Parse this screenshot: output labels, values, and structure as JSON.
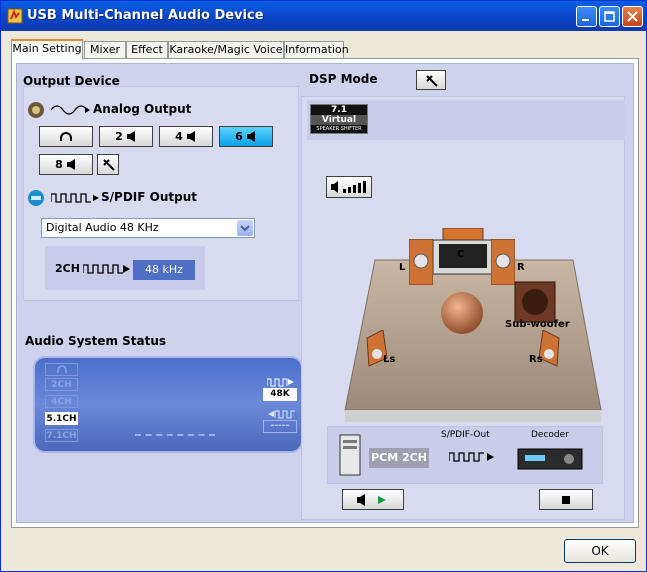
{
  "window": {
    "title": "USB Multi-Channel Audio Device"
  },
  "tabs": [
    "Main Setting",
    "Mixer",
    "Effect",
    "Karaoke/Magic Voice",
    "Information"
  ],
  "output_device": {
    "heading": "Output Device",
    "analog_label": "Analog Output",
    "channel_buttons": [
      "2",
      "4",
      "6",
      "8"
    ],
    "selected_channels": "6",
    "spdif_label": "S/PDIF Output",
    "spdif_select": "Digital Audio 48 KHz",
    "rate_prefix": "2CH",
    "rate_value": "48 kHz"
  },
  "audio_status": {
    "heading": "Audio System Status",
    "modes": [
      "2CH",
      "4CH",
      "5.1CH",
      "7.1CH"
    ],
    "active_mode": "5.1CH",
    "sample_rate": "48K",
    "input_rate": "-----"
  },
  "dsp": {
    "heading": "DSP Mode",
    "virtual_badge": {
      "line1": "7.1",
      "line2": "Virtual",
      "line3": "SPEAKER SHIFTER"
    },
    "speakers": {
      "left": "L",
      "center": "C",
      "right": "R",
      "sub": "Sub-woofer",
      "ls": "Ls",
      "rs": "Rs"
    },
    "pcm_label": "PCM 2CH",
    "spdif_out_label": "S/PDIF-Out",
    "decoder_label": "Decoder"
  },
  "footer": {
    "ok_label": "OK"
  }
}
